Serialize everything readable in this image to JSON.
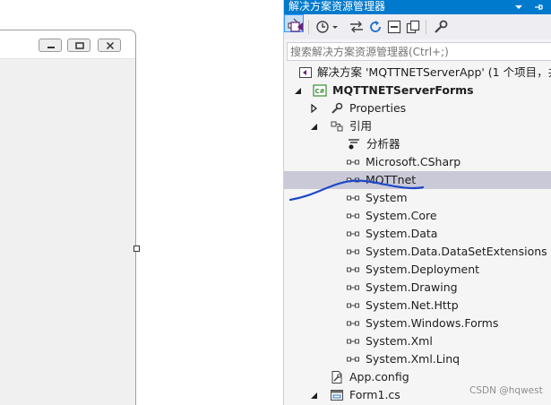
{
  "solution_explorer": {
    "title": "解决方案资源管理器",
    "search_placeholder": "搜索解决方案资源管理器(Ctrl+;)",
    "tree": {
      "solution": "解决方案 'MQTTNETServerApp' (1 个项目，共",
      "project": "MQTTNETServerForms",
      "properties": "Properties",
      "references": "引用",
      "analyzers": "分析器",
      "refs": [
        "Microsoft.CSharp",
        "MQTTnet",
        "System",
        "System.Core",
        "System.Data",
        "System.Data.DataSetExtensions",
        "System.Deployment",
        "System.Drawing",
        "System.Net.Http",
        "System.Windows.Forms",
        "System.Xml",
        "System.Xml.Linq"
      ],
      "app_config": "App.config",
      "form1": "Form1.cs",
      "selected_item": "MQTTnet"
    }
  },
  "watermark": "CSDN @hqwest",
  "colors": {
    "title_bar": "#007acc",
    "selection": "#c9c9d8",
    "annotation": "#1f47c8"
  }
}
